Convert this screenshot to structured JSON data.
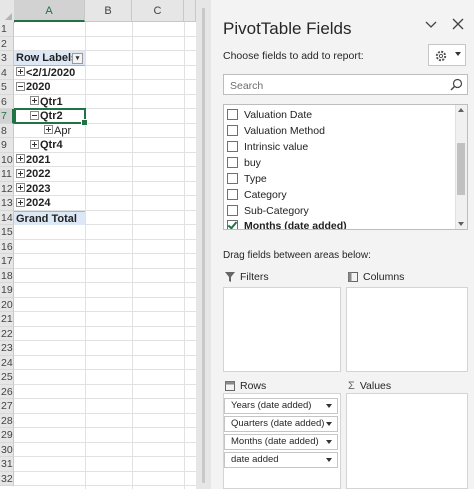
{
  "sheet": {
    "columns": [
      "A",
      "B",
      "C"
    ],
    "rows": [
      "1",
      "2",
      "3",
      "4",
      "5",
      "6",
      "7",
      "8",
      "9",
      "10",
      "11",
      "12",
      "13",
      "14",
      "15",
      "16",
      "17",
      "18",
      "19",
      "20",
      "21",
      "22",
      "23",
      "24",
      "25",
      "26",
      "27",
      "28",
      "29",
      "30",
      "31",
      "32"
    ],
    "pivot": {
      "header": "Row Labels",
      "items": [
        {
          "label": "<2/1/2020",
          "toggle": "plus"
        },
        {
          "label": "2020",
          "toggle": "minus"
        },
        {
          "label": "Qtr1",
          "toggle": "plus"
        },
        {
          "label": "Qtr2",
          "toggle": "minus"
        },
        {
          "label": "Apr",
          "toggle": "plus"
        },
        {
          "label": "Qtr4",
          "toggle": "plus"
        },
        {
          "label": "2021",
          "toggle": "plus"
        },
        {
          "label": "2022",
          "toggle": "plus"
        },
        {
          "label": "2023",
          "toggle": "plus"
        },
        {
          "label": "2024",
          "toggle": "plus"
        }
      ],
      "grand_total": "Grand Total"
    }
  },
  "panel": {
    "title": "PivotTable Fields",
    "choose_label": "Choose fields to add to report:",
    "search_placeholder": "Search",
    "fields": [
      {
        "label": "Valuation Date",
        "checked": false
      },
      {
        "label": "Valuation Method",
        "checked": false
      },
      {
        "label": "Intrinsic value",
        "checked": false
      },
      {
        "label": "buy",
        "checked": false
      },
      {
        "label": "Type",
        "checked": false
      },
      {
        "label": "Category",
        "checked": false
      },
      {
        "label": "Sub-Category",
        "checked": false
      },
      {
        "label": "Months (date added)",
        "checked": true
      }
    ],
    "drag_label": "Drag fields between areas below:",
    "areas": {
      "filters": "Filters",
      "columns": "Columns",
      "rows": "Rows",
      "values": "Values"
    },
    "row_fields": [
      "Years (date added)",
      "Quarters (date added)",
      "Months (date added)",
      "date added"
    ]
  },
  "colors": {
    "accent": "#217346",
    "pivot_band": "#dde8f6"
  }
}
